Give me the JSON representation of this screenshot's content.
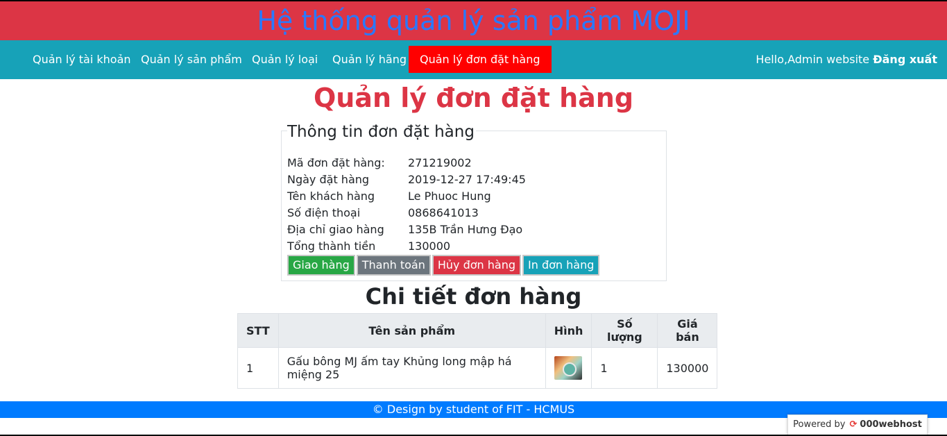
{
  "header": {
    "title": "Hệ thống quản lý sản phẩm MOJI"
  },
  "nav": {
    "items": [
      {
        "label": "Quản lý tài khoản"
      },
      {
        "label": "Quản lý sản phẩm"
      },
      {
        "label": "Quản lý loại"
      },
      {
        "label": "Quản lý hãng"
      },
      {
        "label": "Quản lý đơn đặt hàng"
      }
    ],
    "greeting": "Hello,Admin website",
    "logout": "Đăng xuất"
  },
  "page_title": "Quản lý đơn đặt hàng",
  "order_info": {
    "legend": "Thông tin đơn đặt hàng",
    "rows": [
      {
        "label": "Mã đơn đặt hàng:",
        "value": "271219002"
      },
      {
        "label": "Ngày đặt hàng",
        "value": "2019-12-27 17:49:45"
      },
      {
        "label": "Tên khách hàng",
        "value": "Le Phuoc Hung"
      },
      {
        "label": "Số điện thoại",
        "value": "0868641013"
      },
      {
        "label": "Địa chỉ giao hàng",
        "value": "135B Trần Hưng Đạo"
      },
      {
        "label": "Tổng thành tiền",
        "value": "130000"
      }
    ],
    "buttons": {
      "deliver": "Giao hàng",
      "pay": "Thanh toán",
      "cancel": "Hủy đơn hàng",
      "print": "In đơn hàng"
    }
  },
  "details": {
    "title": "Chi tiết đơn hàng",
    "headers": [
      "STT",
      "Tên sản phẩm",
      "Hình",
      "Số lượng",
      "Giá bán"
    ],
    "rows": [
      {
        "stt": "1",
        "name": "Gấu bông MJ ấm tay Khủng long mập há miệng 25",
        "qty": "1",
        "price": "130000"
      }
    ]
  },
  "footer": {
    "text": "© Design by student of FIT - HCMUS"
  },
  "powered": {
    "prefix": "Powered by",
    "brand": "000webhost"
  },
  "colors": {
    "header_bg": "#dc3545",
    "title_text": "#2979ff",
    "nav_bg": "#17a2b8",
    "nav_active": "#ff0000",
    "footer_bg": "#007bff"
  }
}
